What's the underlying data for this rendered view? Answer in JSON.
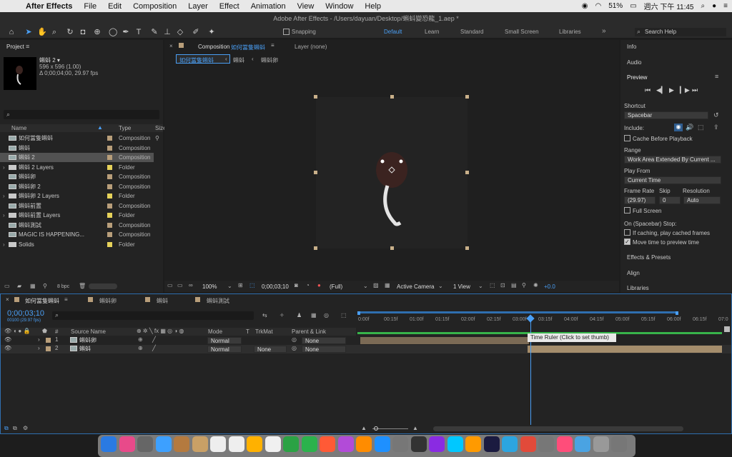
{
  "menubar": {
    "app": "After Effects",
    "items": [
      "File",
      "Edit",
      "Composition",
      "Layer",
      "Effect",
      "Animation",
      "View",
      "Window",
      "Help"
    ],
    "battery": "51%",
    "clock": "週六 下午 11:45"
  },
  "title": "Adobe After Effects - /Users/dayuan/Desktop/蝌蚪變恐龍_1.aep *",
  "toolbar": {
    "snapping": "Snapping",
    "workspaces": [
      "Default",
      "Learn",
      "Standard",
      "Small Screen",
      "Libraries"
    ],
    "search": "Search Help"
  },
  "project": {
    "title": "Project",
    "item_name": "蝌蚪 2 ▾",
    "item_info1": "596 x 596 (1.00)",
    "item_info2": "Δ 0;00;04;00, 29.97 fps",
    "col_name": "Name",
    "col_type": "Type",
    "col_size": "Size",
    "rows": [
      {
        "name": "如何當隻蝌蚪",
        "type": "Composition",
        "kind": "comp",
        "color": "#b89e7a"
      },
      {
        "name": "蝌蚪",
        "type": "Composition",
        "kind": "comp",
        "color": "#b89e7a"
      },
      {
        "name": "蝌蚪 2",
        "type": "Composition",
        "kind": "comp",
        "color": "#b89e7a"
      },
      {
        "name": "蝌蚪 2 Layers",
        "type": "Folder",
        "kind": "folder",
        "color": "#e6d25a"
      },
      {
        "name": "蝌蚪卵",
        "type": "Composition",
        "kind": "comp",
        "color": "#b89e7a"
      },
      {
        "name": "蝌蚪卵 2",
        "type": "Composition",
        "kind": "comp",
        "color": "#b89e7a"
      },
      {
        "name": "蝌蚪卵 2 Layers",
        "type": "Folder",
        "kind": "folder",
        "color": "#e6d25a"
      },
      {
        "name": "蝌蚪前置",
        "type": "Composition",
        "kind": "comp",
        "color": "#b89e7a"
      },
      {
        "name": "蝌蚪前置 Layers",
        "type": "Folder",
        "kind": "folder",
        "color": "#e6d25a"
      },
      {
        "name": "蝌蚪測試",
        "type": "Composition",
        "kind": "comp",
        "color": "#b89e7a"
      },
      {
        "name": "MAGIC IS HAPPENING...",
        "type": "Composition",
        "kind": "comp",
        "color": "#b89e7a"
      },
      {
        "name": "Solids",
        "type": "Folder",
        "kind": "folder",
        "color": "#e6d25a"
      }
    ],
    "bpc": "8 bpc"
  },
  "comp": {
    "tab_prefix": "Composition",
    "tab_name": "如何當隻蝌蚪",
    "layer_tab": "Layer (none)",
    "breadcrumbs": [
      "如何當隻蝌蚪",
      "蝌蚪",
      "蝌蚪卵"
    ],
    "zoom": "100%",
    "timecode": "0;00;03;10",
    "resolution": "(Full)",
    "camera": "Active Camera",
    "views": "1 View",
    "exposure": "+0.0"
  },
  "right": {
    "info": "Info",
    "audio": "Audio",
    "preview": "Preview",
    "shortcut": "Shortcut",
    "shortcut_val": "Spacebar",
    "include": "Include:",
    "cache": "Cache Before Playback",
    "range": "Range",
    "range_val": "Work Area Extended By Current ...",
    "play_from": "Play From",
    "play_from_val": "Current Time",
    "frame_rate": "Frame Rate",
    "skip": "Skip",
    "resolution": "Resolution",
    "fr_val": "(29.97)",
    "skip_val": "0",
    "res_val": "Auto",
    "full_screen": "Full Screen",
    "stop": "On (Spacebar) Stop:",
    "if_caching": "If caching, play cached frames",
    "move_time": "Move time to preview time",
    "effects": "Effects & Presets",
    "align": "Align",
    "libraries": "Libraries"
  },
  "timeline": {
    "tabs": [
      "如何當隻蝌蚪",
      "蝌蚪卵",
      "蝌蚪",
      "蝌蚪測試"
    ],
    "timecode": "0;00;03;10",
    "fps": "00100 (29.97 fps)",
    "col_source": "Source Name",
    "col_mode": "Mode",
    "col_t": "T",
    "col_trkmat": "TrkMat",
    "col_parent": "Parent & Link",
    "layers": [
      {
        "num": "1",
        "name": "蝌蚪卵",
        "mode": "Normal",
        "trkmat": "",
        "parent": "None",
        "color": "#b89e7a"
      },
      {
        "num": "2",
        "name": "蝌蚪",
        "mode": "Normal",
        "trkmat": "None",
        "parent": "None",
        "color": "#b89e7a"
      }
    ],
    "ticks": [
      "0:00f",
      "00:15f",
      "01:00f",
      "01:15f",
      "02:00f",
      "02:15f",
      "03:00f",
      "03:15f",
      "04:00f",
      "04:15f",
      "05:00f",
      "05:15f",
      "06:00f",
      "06:15f",
      "07:0"
    ],
    "tooltip": "Time Ruler (Click to set thumb)"
  }
}
